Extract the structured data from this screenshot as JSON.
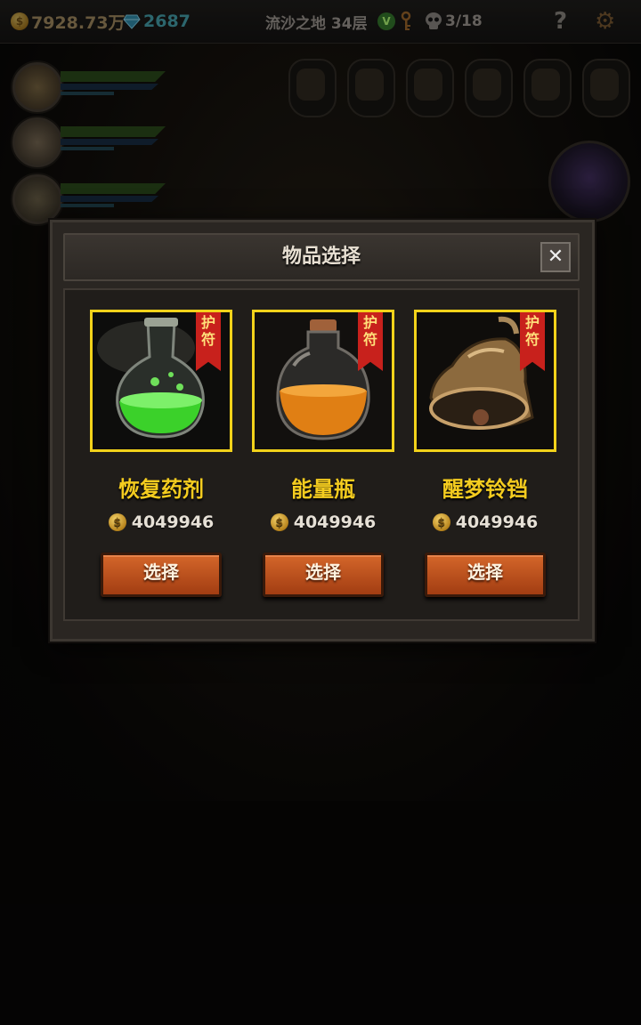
{
  "topbar": {
    "gold": "7928.73万",
    "gems": "2687",
    "floor": "流沙之地 34层",
    "v_badge": "V",
    "skull_count": "3/18",
    "help": "?"
  },
  "dialog": {
    "title": "物品选择",
    "close": "✕",
    "items": [
      {
        "name": "恢复药剂",
        "badge": "护符",
        "price": "4049946",
        "button": "选择",
        "icon": "green-potion-icon"
      },
      {
        "name": "能量瓶",
        "badge": "护符",
        "price": "4049946",
        "button": "选择",
        "icon": "orange-bottle-icon"
      },
      {
        "name": "醒梦铃铛",
        "badge": "护符",
        "price": "4049946",
        "button": "选择",
        "icon": "bell-icon"
      }
    ]
  },
  "colors": {
    "item_name": "#f4cc1f",
    "frame": "#f2d21a",
    "ribbon": "#c8211c",
    "button": "#c25224"
  }
}
